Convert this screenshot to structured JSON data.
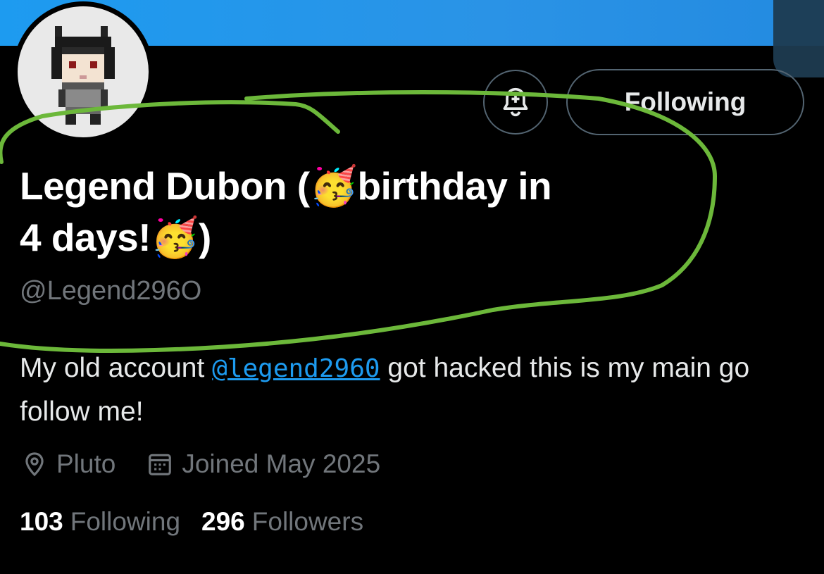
{
  "profile": {
    "display_name_line1": "Legend Dubon (🥳birthday in",
    "display_name_line2": "4 days!🥳)",
    "handle": "@Legend296O",
    "bio_before": "My old account ",
    "bio_mention": "@legend2960",
    "bio_after": " got hacked this is my main go follow me!",
    "location": "Pluto",
    "joined": "Joined May 2025",
    "following_count": "103",
    "following_label": "Following",
    "followers_count": "296",
    "followers_label": "Followers"
  },
  "actions": {
    "follow_label": "Following",
    "notifications_icon": "bell-plus-icon"
  },
  "colors": {
    "banner": "#1d9bf0",
    "link": "#1d9bf0",
    "muted": "#71767b",
    "annotation": "#6cb83a"
  }
}
